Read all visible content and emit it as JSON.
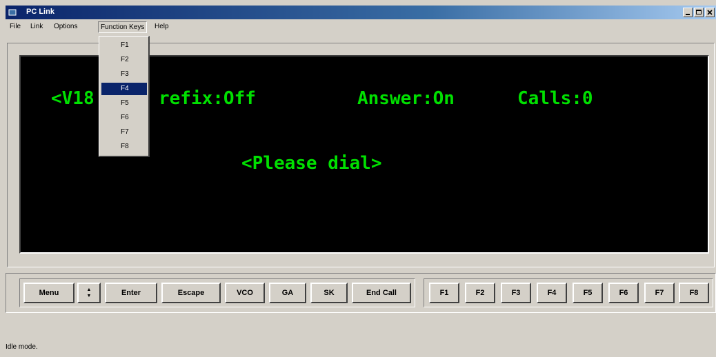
{
  "window": {
    "title": "PC Link",
    "controls": [
      "minimize-icon",
      "maximize-icon",
      "close-icon"
    ]
  },
  "menubar": {
    "items": [
      {
        "label": "File"
      },
      {
        "label": "Link"
      },
      {
        "label": "Options"
      },
      {
        "label": "Function Keys"
      },
      {
        "label": "Help"
      }
    ]
  },
  "function_keys_menu": {
    "items": [
      "F1",
      "F2",
      "F3",
      "F4",
      "F5",
      "F6",
      "F7",
      "F8"
    ],
    "highlighted": "F4"
  },
  "screen": {
    "line1_a": "<V18",
    "line1_b": "refix:Off",
    "answer": "Answer:On",
    "calls": "Calls:0",
    "line2": "<Please dial>",
    "text_color": "#00e000",
    "bg_color": "#000000"
  },
  "buttons": {
    "menu": "Menu",
    "spin_up": "▲",
    "spin_down": "▼",
    "enter": "Enter",
    "escape": "Escape",
    "vco": "VCO",
    "ga": "GA",
    "sk": "SK",
    "end_call": "End Call",
    "fkeys": [
      "F1",
      "F2",
      "F3",
      "F4",
      "F5",
      "F6",
      "F7",
      "F8"
    ]
  },
  "statusbar": {
    "text": "Idle mode."
  }
}
